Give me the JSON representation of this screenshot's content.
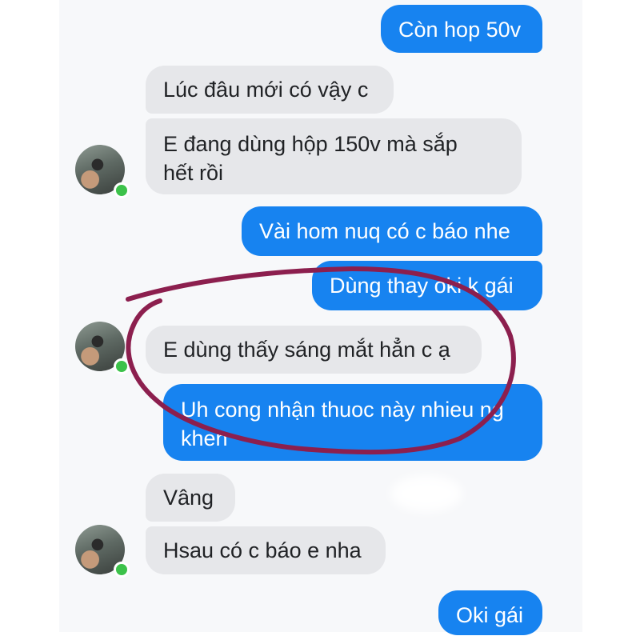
{
  "messages": [
    {
      "id": "m1",
      "direction": "outgoing",
      "text": "Còn hop 50v"
    },
    {
      "id": "m2",
      "direction": "incoming",
      "text": "Lúc đâu mới có vậy c"
    },
    {
      "id": "m3",
      "direction": "incoming",
      "line1": "E đang dùng hộp 150v mà sắp",
      "line2": "hết rồi"
    },
    {
      "id": "m4",
      "direction": "outgoing",
      "text": "Vài hom nuq có c báo nhe"
    },
    {
      "id": "m5",
      "direction": "outgoing",
      "text": "Dùng thay oki k gái"
    },
    {
      "id": "m6",
      "direction": "incoming",
      "text": "E dùng thấy sáng mắt hẳn c ạ"
    },
    {
      "id": "m7",
      "direction": "outgoing",
      "line1": "Uh cong nhận thuoc này nhieu ng",
      "line2": "khen"
    },
    {
      "id": "m8",
      "direction": "incoming",
      "text": "Vâng"
    },
    {
      "id": "m9",
      "direction": "incoming",
      "text": "Hsau có c báo e nha"
    },
    {
      "id": "m10",
      "direction": "outgoing",
      "text": "Oki gái"
    }
  ],
  "colors": {
    "outgoing_bubble": "#1783f0",
    "incoming_bubble": "#e6e7ea",
    "presence": "#3cc24a",
    "highlight_annotation": "#8c1f4e"
  },
  "icons": {
    "avatar": "contact-avatar",
    "presence": "online-status-dot"
  }
}
